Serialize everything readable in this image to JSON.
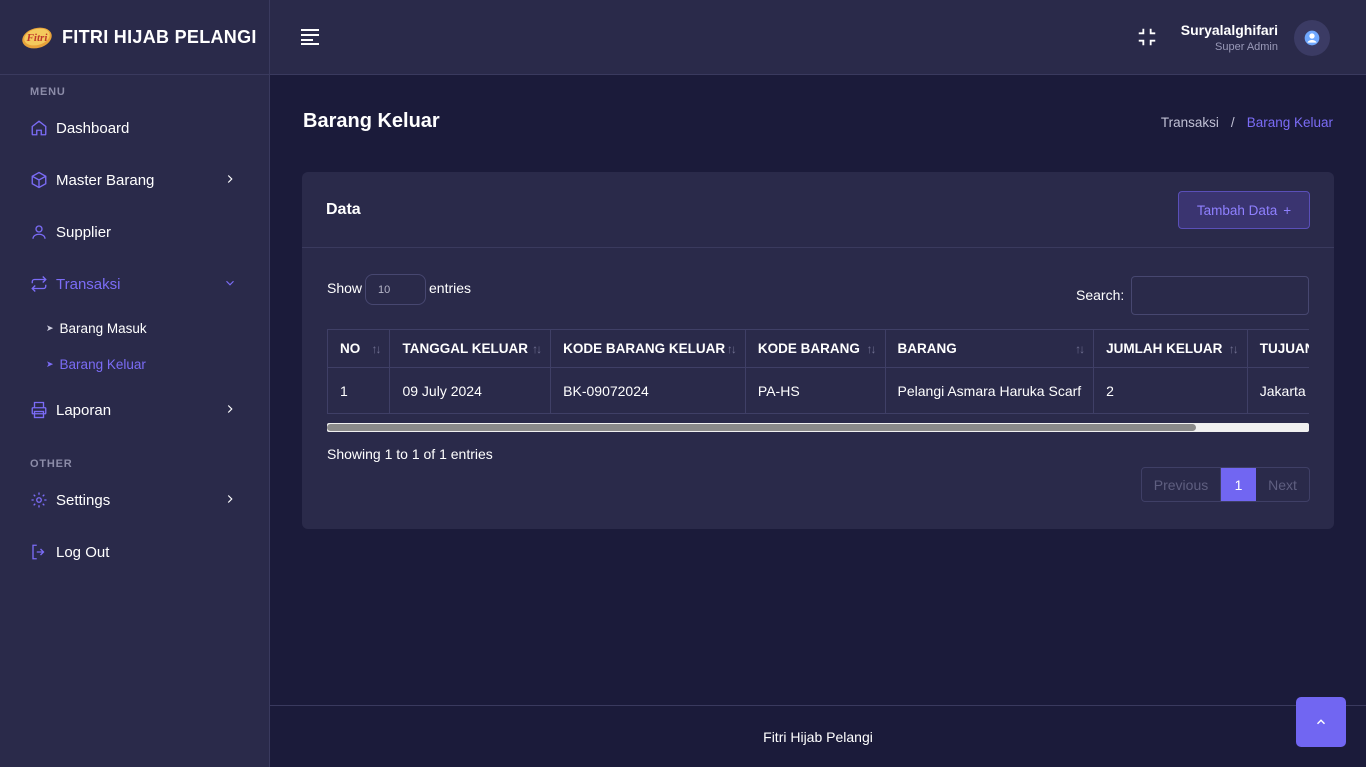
{
  "brand": {
    "title": "FITRI HIJAB PELANGI",
    "logo_text": "Fitri"
  },
  "sidebar": {
    "sections": {
      "menu": "MENU",
      "other": "OTHER"
    },
    "items": [
      {
        "label": "Dashboard",
        "icon": "home-icon"
      },
      {
        "label": "Master Barang",
        "icon": "box-icon"
      },
      {
        "label": "Supplier",
        "icon": "user-icon"
      },
      {
        "label": "Transaksi",
        "icon": "repeat-icon"
      },
      {
        "label": "Laporan",
        "icon": "printer-icon"
      },
      {
        "label": "Settings",
        "icon": "gear-icon"
      },
      {
        "label": "Log Out",
        "icon": "logout-icon"
      }
    ],
    "transaksi_sub": [
      {
        "label": "Barang Masuk"
      },
      {
        "label": "Barang Keluar"
      }
    ]
  },
  "topbar": {
    "user_name": "Suryalalghifari",
    "user_role": "Super Admin"
  },
  "page": {
    "title": "Barang Keluar",
    "breadcrumb": {
      "parent": "Transaksi",
      "separator": "/",
      "current": "Barang Keluar"
    }
  },
  "card": {
    "title": "Data",
    "add_button": "Tambah Data",
    "add_icon": "+",
    "show_label": "Show",
    "page_length": "10",
    "entries_label": "entries",
    "search_label": "Search:",
    "search_value": "",
    "columns": [
      "NO",
      "TANGGAL KELUAR",
      "KODE BARANG KELUAR",
      "KODE BARANG",
      "BARANG",
      "JUMLAH KELUAR",
      "TUJUAN"
    ],
    "rows": [
      [
        "1",
        "09 July 2024",
        "BK-09072024",
        "PA-HS",
        "Pelangi Asmara Haruka Scarf",
        "2",
        "Jakarta"
      ]
    ],
    "info": "Showing 1 to 1 of 1 entries",
    "pagination": {
      "prev": "Previous",
      "current": "1",
      "next": "Next"
    }
  },
  "footer": {
    "text": "Fitri Hijab Pelangi"
  },
  "colors": {
    "accent": "#7166f2",
    "active_text": "#7b6cf6",
    "sidebar_bg": "#2a2a4a",
    "page_bg": "#1b1b3a"
  }
}
